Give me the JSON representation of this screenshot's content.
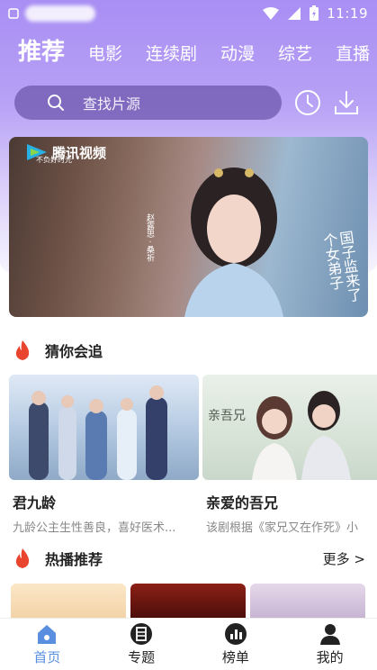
{
  "status_bar": {
    "time": "11:19"
  },
  "tabs": [
    "推荐",
    "电影",
    "连续剧",
    "动漫",
    "综艺",
    "直播"
  ],
  "search": {
    "placeholder": "查找片源"
  },
  "banner": {
    "logo_text": "腾讯视频",
    "logo_slogan": "不负好时光",
    "cast": "赵露思 · 桑祈",
    "title": "国子监来了个女弟子"
  },
  "section_guess": {
    "title": "猜你会追"
  },
  "cards": [
    {
      "title": "君九龄",
      "desc": "九龄公主生性善良，喜好医术..."
    },
    {
      "title": "亲爱的吾兄",
      "desc": "该剧根据《家兄又在作死》小"
    }
  ],
  "section_hot": {
    "title": "热播推荐",
    "more": "更多 >"
  },
  "bottom_nav": [
    {
      "label": "首页"
    },
    {
      "label": "专题"
    },
    {
      "label": "榜单"
    },
    {
      "label": "我的"
    }
  ],
  "colors": {
    "accent": "#5a8fe0",
    "header": "#a98ef4",
    "fire": "#e8442e"
  }
}
